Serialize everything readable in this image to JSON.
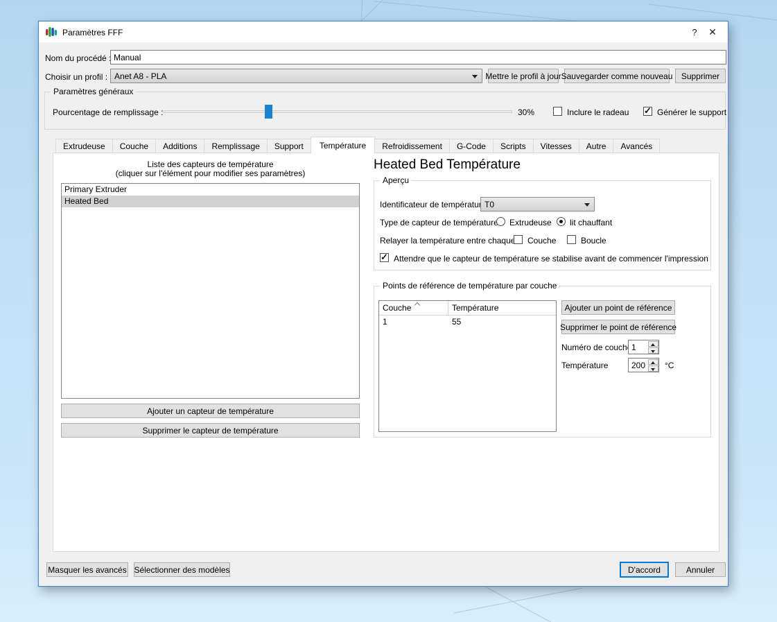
{
  "window": {
    "title": "Paramètres FFF",
    "help_button": "?",
    "close_button": "✕"
  },
  "process": {
    "name_label": "Nom du procédé :",
    "name_value": "Manual",
    "profile_label": "Choisir un profil :",
    "profile_value": "Anet A8 - PLA",
    "update_profile_button": "Mettre le profil à jour",
    "save_as_new_button": "Sauvegarder comme nouveau",
    "delete_button": "Supprimer"
  },
  "general": {
    "group_title": "Paramètres généraux",
    "infill_label": "Pourcentage de remplissage :",
    "infill_percent": 30,
    "infill_value": "30%",
    "raft_label": "Inclure le radeau",
    "raft_checked": false,
    "support_label": "Générer le support",
    "support_checked": true
  },
  "tabs": {
    "items": [
      "Extrudeuse",
      "Couche",
      "Additions",
      "Remplissage",
      "Support",
      "Température",
      "Refroidissement",
      "G-Code",
      "Scripts",
      "Vitesses",
      "Autre",
      "Avancés"
    ],
    "active": "Température"
  },
  "sensor_list": {
    "title": "Liste des capteurs de température",
    "subtitle": "(cliquer sur l'élément pour modifier ses paramètres)",
    "items": [
      "Primary Extruder",
      "Heated Bed"
    ],
    "selected": "Heated Bed",
    "add_button": "Ajouter un capteur de température",
    "remove_button": "Supprimer le capteur de température"
  },
  "detail": {
    "title": "Heated Bed Température",
    "overview": {
      "group_title": "Aperçu",
      "identifier_label": "Identificateur de température",
      "identifier_value": "T0",
      "type_label": "Type de capteur de température :",
      "type_options": [
        {
          "label": "Extrudeuse",
          "selected": false
        },
        {
          "label": "lit chauffant",
          "selected": true
        }
      ],
      "relay_label": "Relayer la température entre chaque :",
      "relay_options": [
        {
          "label": "Couche",
          "checked": false
        },
        {
          "label": "Boucle",
          "checked": false
        }
      ],
      "wait_label": "Attendre que le capteur de température se stabilise avant de commencer l'impression",
      "wait_checked": true
    },
    "setpoints": {
      "group_title": "Points de référence de température par couche",
      "table": {
        "columns": [
          "Couche",
          "Température"
        ],
        "rows": [
          [
            "1",
            "55"
          ]
        ]
      },
      "add_button": "Ajouter un point de référence",
      "remove_button": "Supprimer le point de référence",
      "layer_label": "Numéro de couche",
      "layer_value": "1",
      "temp_label": "Température",
      "temp_value": "200",
      "temp_unit": "°C"
    }
  },
  "footer": {
    "hide_advanced_button": "Masquer les avancés",
    "select_models_button": "Sélectionner des modèles",
    "ok_button": "D'accord",
    "cancel_button": "Annuler"
  },
  "colors": {
    "accent": "#0078d7",
    "window_border": "#4e8bc8",
    "slider_handle": "#1e82d2",
    "selection_gray": "#d2d2d2"
  }
}
